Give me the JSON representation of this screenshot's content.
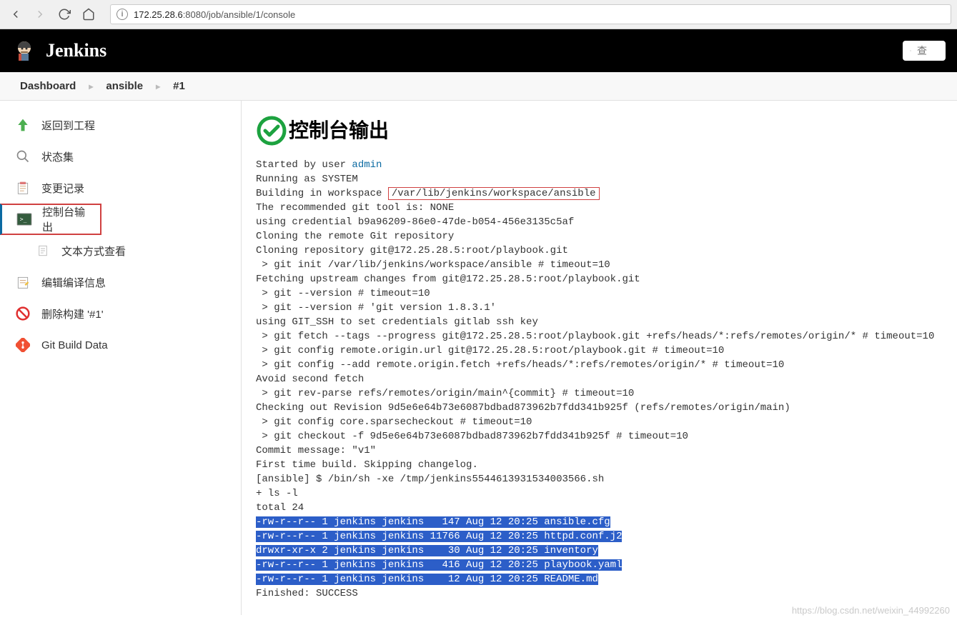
{
  "browser": {
    "url_prefix": "172.25.28.6",
    "url_rest": ":8080/job/ansible/1/console"
  },
  "header": {
    "brand": "Jenkins",
    "search_placeholder": "查"
  },
  "breadcrumbs": {
    "dashboard": "Dashboard",
    "job": "ansible",
    "build": "#1"
  },
  "sidebar": {
    "back_to_project": "返回到工程",
    "status": "状态集",
    "changes": "变更记录",
    "console_output": "控制台输出",
    "view_as_plain": "文本方式查看",
    "edit_build_info": "编辑编译信息",
    "delete_build": "删除构建 '#1'",
    "git_build_data": "Git Build Data"
  },
  "page": {
    "title": "控制台输出"
  },
  "console": {
    "started_by": "Started by user ",
    "admin_user": "admin",
    "running_as": "Running as SYSTEM",
    "building_in": "Building in workspace ",
    "workspace_path": "/var/lib/jenkins/workspace/ansible",
    "line_git_tool": "The recommended git tool is: NONE",
    "line_cred": "using credential b9a96209-86e0-47de-b054-456e3135c5af",
    "line_cloning": "Cloning the remote Git repository",
    "line_clone_repo": "Cloning repository git@172.25.28.5:root/playbook.git",
    "line_git_init": " > git init /var/lib/jenkins/workspace/ansible # timeout=10",
    "line_fetch_upstream": "Fetching upstream changes from git@172.25.28.5:root/playbook.git",
    "line_gv1": " > git --version # timeout=10",
    "line_gv2": " > git --version # 'git version 1.8.3.1'",
    "line_ssh": "using GIT_SSH to set credentials gitlab ssh key",
    "line_fetch": " > git fetch --tags --progress git@172.25.28.5:root/playbook.git +refs/heads/*:refs/remotes/origin/* # timeout=10",
    "line_cfg_url": " > git config remote.origin.url git@172.25.28.5:root/playbook.git # timeout=10",
    "line_cfg_add": " > git config --add remote.origin.fetch +refs/heads/*:refs/remotes/origin/* # timeout=10",
    "line_avoid": "Avoid second fetch",
    "line_revparse": " > git rev-parse refs/remotes/origin/main^{commit} # timeout=10",
    "line_checkout_rev": "Checking out Revision 9d5e6e64b73e6087bdbad873962b7fdd341b925f (refs/remotes/origin/main)",
    "line_sparse": " > git config core.sparsecheckout # timeout=10",
    "line_checkout_f": " > git checkout -f 9d5e6e64b73e6087bdbad873962b7fdd341b925f # timeout=10",
    "line_commit_msg": "Commit message: \"v1\"",
    "line_first_build": "First time build. Skipping changelog.",
    "line_sh": "[ansible] $ /bin/sh -xe /tmp/jenkins5544613931534003566.sh",
    "line_ls": "+ ls -l",
    "line_total": "total 24",
    "ls1": "-rw-r--r-- 1 jenkins jenkins   147 Aug 12 20:25 ansible.cfg",
    "ls2": "-rw-r--r-- 1 jenkins jenkins 11766 Aug 12 20:25 httpd.conf.j2",
    "ls3": "drwxr-xr-x 2 jenkins jenkins    30 Aug 12 20:25 inventory",
    "ls4": "-rw-r--r-- 1 jenkins jenkins   416 Aug 12 20:25 playbook.yaml",
    "ls5": "-rw-r--r-- 1 jenkins jenkins    12 Aug 12 20:25 README.md",
    "finished": "Finished: SUCCESS"
  },
  "watermark": "https://blog.csdn.net/weixin_44992260"
}
